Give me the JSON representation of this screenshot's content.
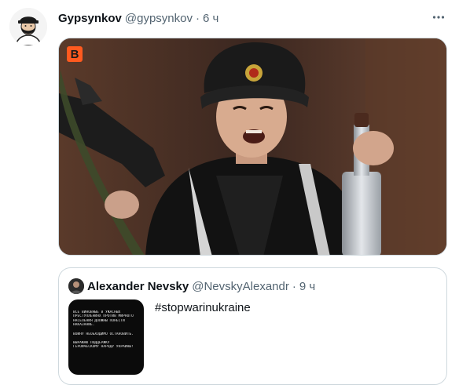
{
  "tweet": {
    "author_name": "Gypsynkov",
    "author_handle": "@gypsynkov",
    "separator": "·",
    "time": "6 ч",
    "more_icon": "more-horizontal-icon",
    "media": {
      "logo_letter": "B"
    }
  },
  "quote": {
    "author_name": "Alexander Nevsky",
    "author_handle": "@NevskyAlexandr",
    "separator": "·",
    "time": "9 ч",
    "text": "#stopwarinukraine",
    "thumb_lines": [
      "ВСЕ ВИНОВНЫЕ В УЖАСНЫХ",
      "ПРЕСТУПЛЕНИЯХ ПРОТИВ МИРНОГО",
      "НАСЕЛЕНИЯ ДОЛЖНЫ ПОНЕСТИ",
      "НАКАЗАНИЕ.",
      "",
      "ВОЙНУ НЕОБХОДИМО ОСТАНОВИТЬ.",
      "",
      "ВЫРАЖАЮ ПОДДЕРЖКУ",
      "ГЕРОИЧЕСКОМУ НАРОДУ УКРАИНЫ!"
    ]
  }
}
